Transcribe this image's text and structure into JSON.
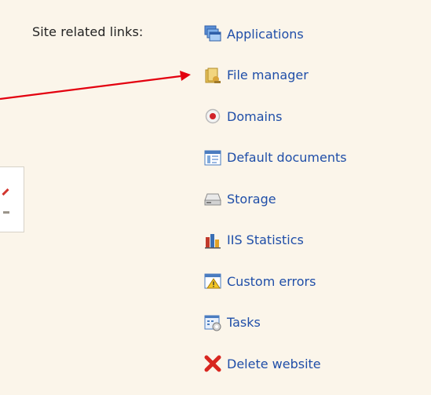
{
  "heading": "Site related links:",
  "links": [
    {
      "label": "Applications",
      "icon": "applications-icon"
    },
    {
      "label": "File manager",
      "icon": "file-manager-icon"
    },
    {
      "label": "Domains",
      "icon": "domains-icon"
    },
    {
      "label": "Default documents",
      "icon": "default-documents-icon"
    },
    {
      "label": "Storage",
      "icon": "storage-icon"
    },
    {
      "label": "IIS Statistics",
      "icon": "iis-statistics-icon"
    },
    {
      "label": "Custom errors",
      "icon": "custom-errors-icon"
    },
    {
      "label": "Tasks",
      "icon": "tasks-icon"
    },
    {
      "label": "Delete website",
      "icon": "delete-website-icon"
    }
  ],
  "colors": {
    "background": "#fbf5ea",
    "link": "#1f4ea8",
    "annotation_arrow": "#e3000f"
  }
}
